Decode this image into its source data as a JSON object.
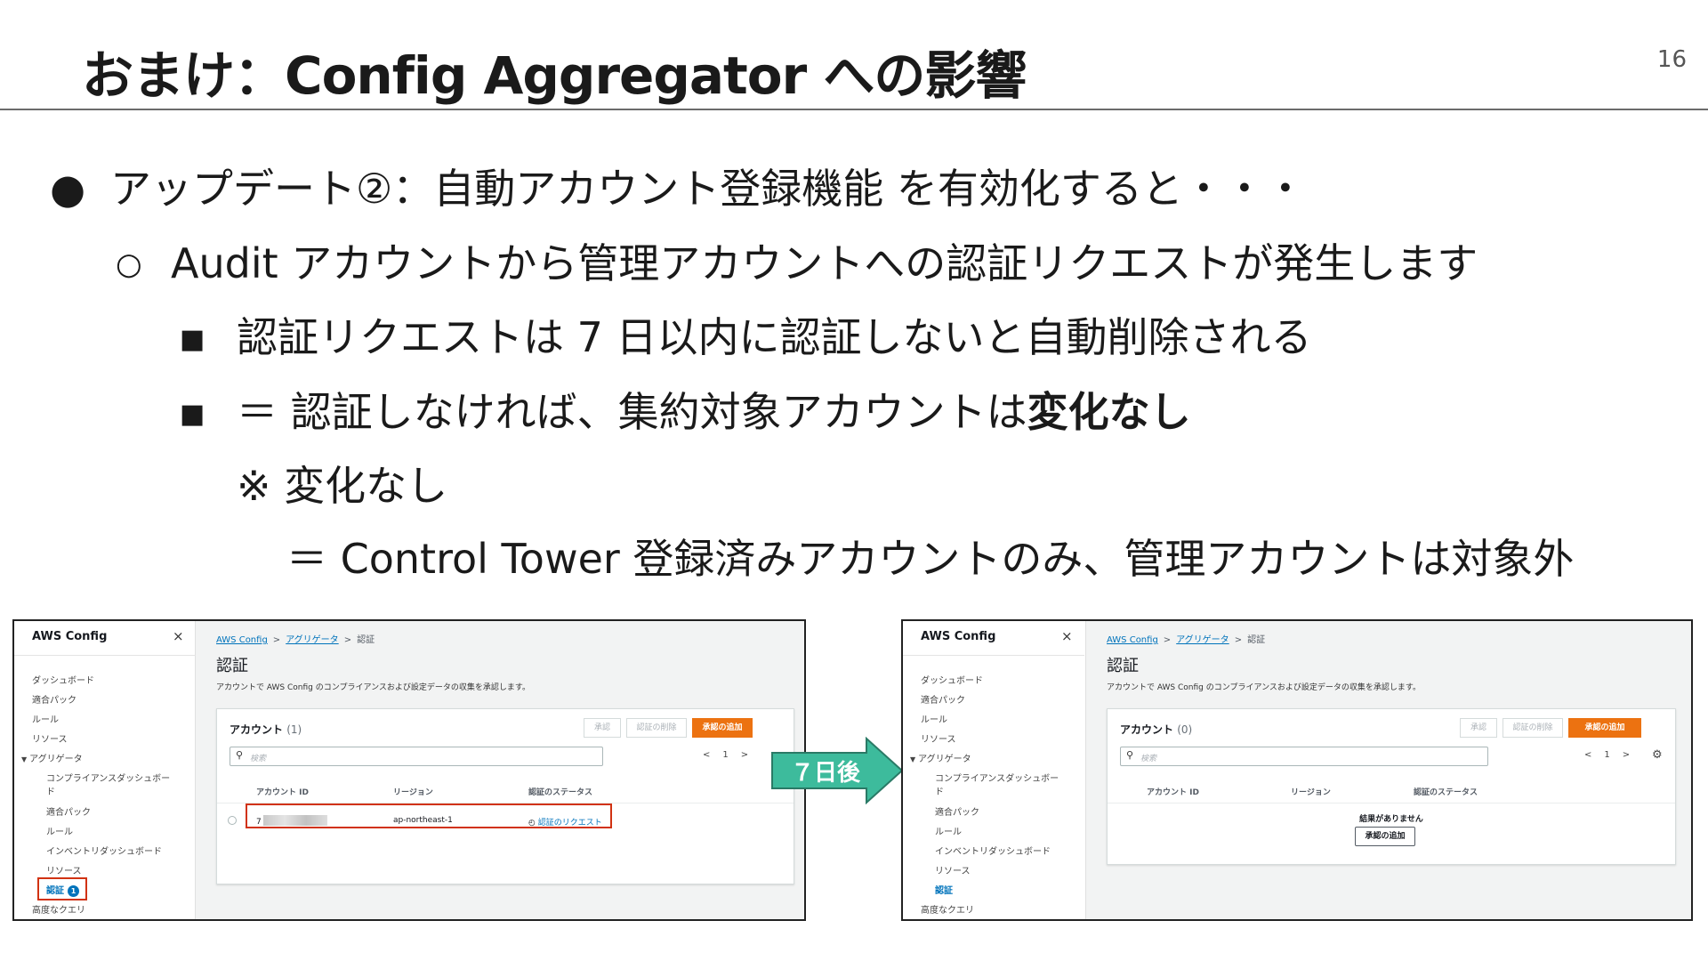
{
  "slide": {
    "title": "おまけ：Config Aggregator への影響",
    "page_number": "16"
  },
  "bullets": {
    "l1_marker": "●",
    "l1": "アップデート②：自動アカウント登録機能 を有効化すると・・・",
    "l2_marker": "○",
    "l2": "Audit アカウントから管理アカウントへの認証リクエストが発生します",
    "l3_marker": "■",
    "l3": "認証リクエストは 7 日以内に認証しないと自動削除される",
    "l4_marker": "■",
    "l4_prefix": "＝ 認証しなければ、集約対象アカウントは",
    "l4_bold": "変化なし",
    "l5": "※ 変化なし",
    "l6": "＝ Control Tower 登録済みアカウントのみ、管理アカウントは対象外"
  },
  "arrow": {
    "label": "７日後",
    "color": "#3dbb9c"
  },
  "left_screen": {
    "sidebar": {
      "title": "AWS Config",
      "close": "×",
      "items": [
        "ダッシュボード",
        "適合パック",
        "ルール",
        "リソース"
      ],
      "group": "アグリゲータ",
      "sub_items": [
        "コンプライアンスダッシュボー",
        "ド",
        "適合パック",
        "ルール",
        "インベントリダッシュボード",
        "リソース"
      ],
      "active": "認証",
      "active_badge": "1",
      "footer": "高度なクエリ"
    },
    "breadcrumb": [
      "AWS Config",
      "アグリゲータ",
      "認証"
    ],
    "breadcrumb_sep": ">",
    "heading": "認証",
    "description": "アカウントで AWS Config のコンプライアンスおよび設定データの収集を承認します。",
    "card": {
      "title": "アカウント",
      "count": "(1)",
      "buttons": {
        "approve": "承認",
        "delete": "認証の削除",
        "add": "承認の追加"
      },
      "search_placeholder": "検索",
      "pager": {
        "prev": "<",
        "page": "1",
        "next": ">"
      },
      "columns": [
        "アカウント ID",
        "リージョン",
        "認証のステータス"
      ],
      "row": {
        "account_id_prefix": "7",
        "region": "ap-northeast-1",
        "status": "認証のリクエスト",
        "status_icon": "clock-icon"
      }
    }
  },
  "right_screen": {
    "sidebar": {
      "title": "AWS Config",
      "close": "×",
      "items": [
        "ダッシュボード",
        "適合パック",
        "ルール",
        "リソース"
      ],
      "group": "アグリゲータ",
      "sub_items": [
        "コンプライアンスダッシュボー",
        "ド",
        "適合パック",
        "ルール",
        "インベントリダッシュボード",
        "リソース"
      ],
      "active": "認証",
      "footer": "高度なクエリ"
    },
    "breadcrumb": [
      "AWS Config",
      "アグリゲータ",
      "認証"
    ],
    "breadcrumb_sep": ">",
    "heading": "認証",
    "description": "アカウントで AWS Config のコンプライアンスおよび設定データの収集を承認します。",
    "card": {
      "title": "アカウント",
      "count": "(0)",
      "buttons": {
        "approve": "承認",
        "delete": "認証の削除",
        "add": "承認の追加"
      },
      "search_placeholder": "検索",
      "pager": {
        "prev": "<",
        "page": "1",
        "next": ">"
      },
      "settings_icon": "gear-icon",
      "columns": [
        "アカウント ID",
        "リージョン",
        "認証のステータス"
      ],
      "empty_message": "結果がありません",
      "empty_button": "承認の追加"
    }
  }
}
